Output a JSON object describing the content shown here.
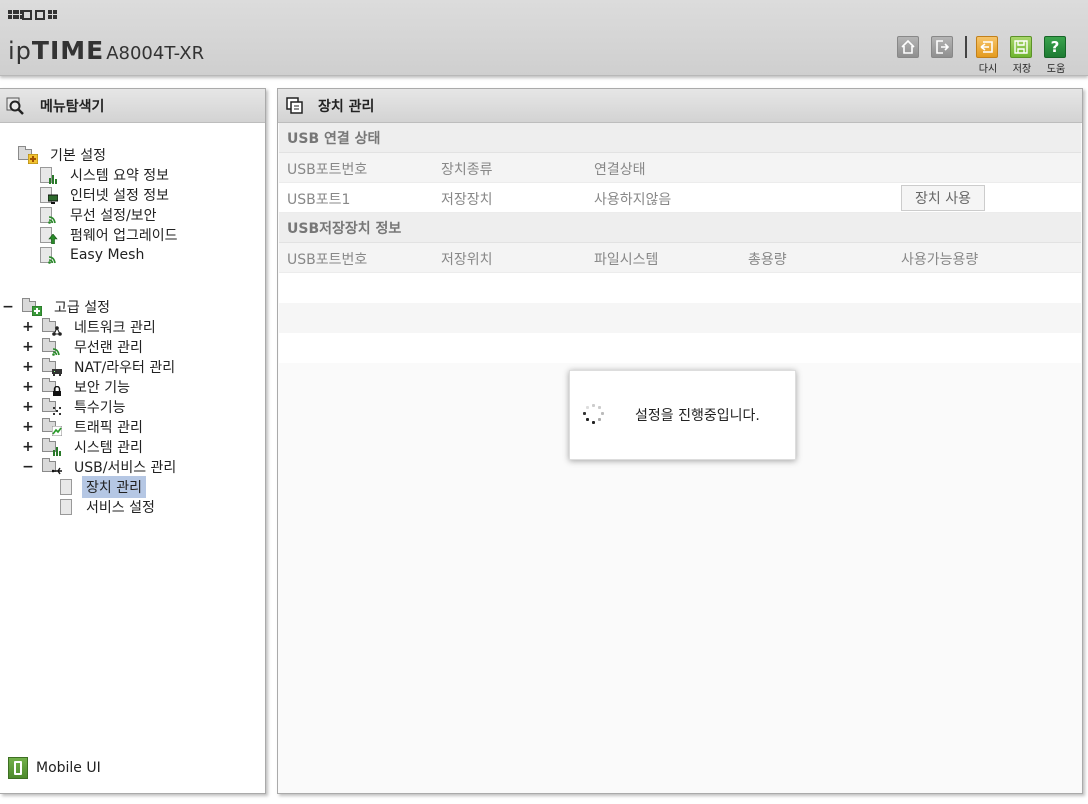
{
  "header": {
    "brand_ip": "ip",
    "brand_time": "TIME",
    "model": "A8004T-XR",
    "buttons": [
      {
        "name": "home",
        "label": ""
      },
      {
        "name": "logout",
        "label": ""
      },
      {
        "name": "reset",
        "label": "다시"
      },
      {
        "name": "save",
        "label": "저장"
      },
      {
        "name": "help",
        "label": "도움"
      }
    ]
  },
  "left": {
    "title": "메뉴탐색기",
    "basic": {
      "label": "기본 설정",
      "items": [
        "시스템 요약 정보",
        "인터넷 설정 정보",
        "무선 설정/보안",
        "펌웨어 업그레이드",
        "Easy Mesh"
      ]
    },
    "advanced": {
      "toggle": "−",
      "label": "고급 설정",
      "items": [
        {
          "toggle": "+",
          "label": "네트워크 관리"
        },
        {
          "toggle": "+",
          "label": "무선랜 관리"
        },
        {
          "toggle": "+",
          "label": "NAT/라우터 관리"
        },
        {
          "toggle": "+",
          "label": "보안 기능"
        },
        {
          "toggle": "+",
          "label": "특수기능"
        },
        {
          "toggle": "+",
          "label": "트래픽 관리"
        },
        {
          "toggle": "+",
          "label": "시스템 관리"
        },
        {
          "toggle": "−",
          "label": "USB/서비스 관리"
        }
      ],
      "sub_items": [
        "장치 관리",
        "서비스 설정"
      ]
    },
    "mobile_label": "Mobile UI"
  },
  "right": {
    "title": "장치 관리",
    "usb_status": {
      "title": "USB 연결 상태",
      "headers": [
        "USB포트번호",
        "장치종류",
        "연결상태"
      ],
      "rows": [
        {
          "port": "USB포트1",
          "type": "저장장치",
          "status": "사용하지않음",
          "button": "장치 사용"
        }
      ]
    },
    "storage": {
      "title": "USB저장장치 정보",
      "headers": [
        "USB포트번호",
        "저장위치",
        "파일시스템",
        "총용량",
        "사용가능용량"
      ]
    }
  },
  "modal": {
    "message": "설정을 진행중입니다."
  },
  "colors": {
    "selected": "#b5c7e4",
    "header_bg": "#d5d5d5",
    "help_green": "#2a8f3e",
    "save_green": "#8cc54c",
    "reset_orange": "#eeb040"
  }
}
